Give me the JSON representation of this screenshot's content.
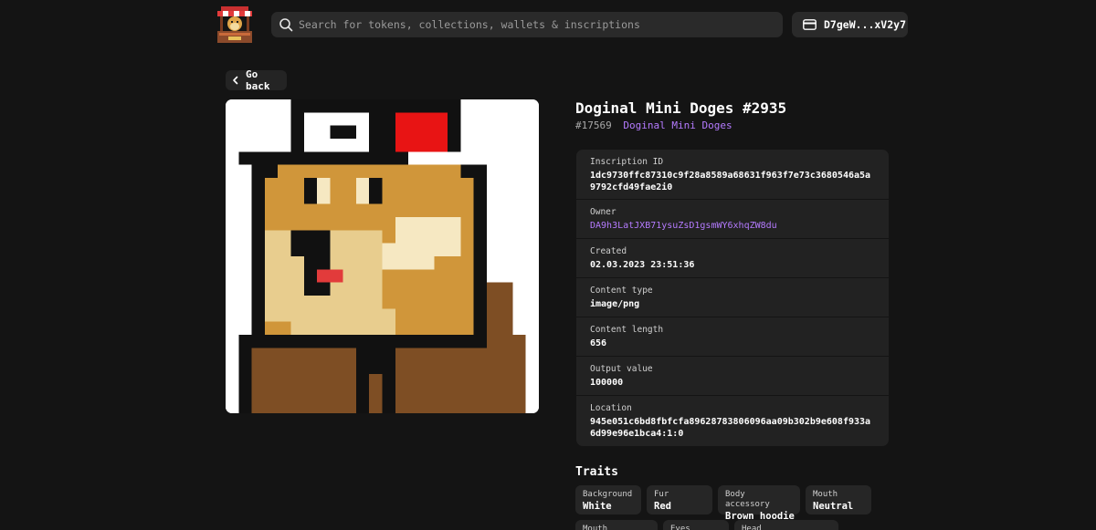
{
  "header": {
    "search_placeholder": "Search for tokens, collections, wallets & inscriptions",
    "wallet_address": "D7geW...xV2y7"
  },
  "nav": {
    "back_label": "Go back"
  },
  "item": {
    "title": "Doginal Mini Doges #2935",
    "number": "#17569",
    "collection": "Doginal Mini Doges"
  },
  "details": [
    {
      "label": "Inscription ID",
      "value": "1dc9730ffc87310c9f28a8589a68631f963f7e73c3680546a5a9792cfd49fae2i0"
    },
    {
      "label": "Owner",
      "value": "DA9h3LatJXB71ysuZsD1gsmWY6xhqZW8du"
    },
    {
      "label": "Created",
      "value": "02.03.2023 23:51:36"
    },
    {
      "label": "Content type",
      "value": "image/png"
    },
    {
      "label": "Content length",
      "value": "656"
    },
    {
      "label": "Output value",
      "value": "100000"
    },
    {
      "label": "Location",
      "value": "945e051c6bd8fbfcfa89628783806096aa09b302b9e608f933a6d99e96e1bca4:1:0"
    }
  ],
  "traits_title": "Traits",
  "traits": [
    {
      "key": "Background",
      "value": "White"
    },
    {
      "key": "Fur",
      "value": "Red"
    },
    {
      "key": "Body accessory",
      "value": "Brown hoodie"
    },
    {
      "key": "Mouth",
      "value": "Neutral"
    },
    {
      "key": "Mouth accessory",
      "value": ""
    },
    {
      "key": "Eyes",
      "value": ""
    },
    {
      "key": "Head",
      "value": ""
    }
  ],
  "colors": {
    "background": "#141414",
    "panel": "#222222",
    "accent_purple": "#b57bff"
  },
  "icons": [
    "shop-logo",
    "search-icon",
    "wallet-icon",
    "chevron-left-icon"
  ]
}
